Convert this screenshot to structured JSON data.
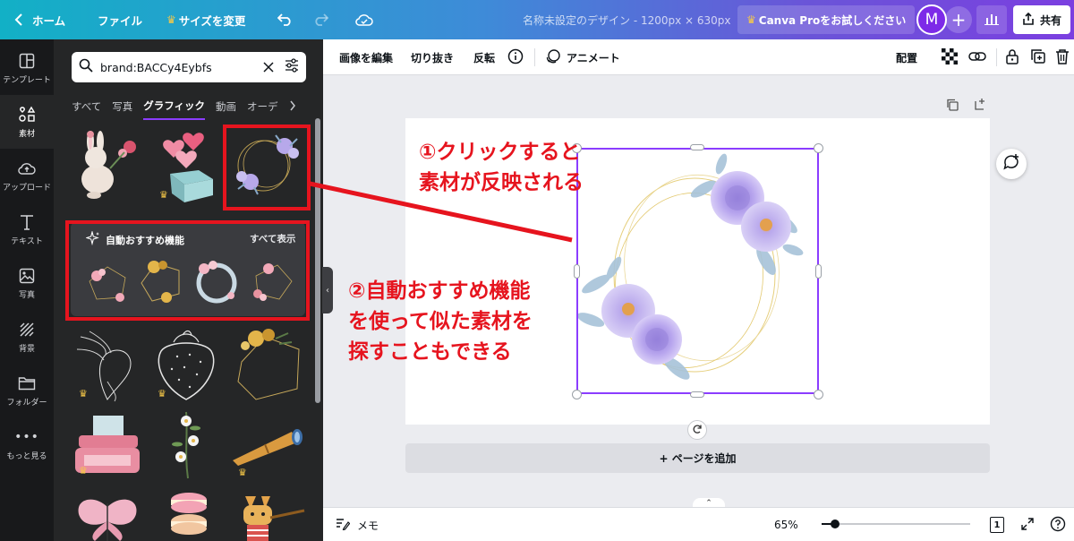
{
  "topbar": {
    "home_label": "ホーム",
    "file_label": "ファイル",
    "resize_label": "サイズを変更",
    "doc_title": "名称未設定のデザイン - 1200px × 630px",
    "pro_label": "Canva Proをお試しください",
    "avatar_initial": "M",
    "share_label": "共有"
  },
  "leftnav": {
    "items": [
      {
        "label": "テンプレート",
        "icon": "template-icon"
      },
      {
        "label": "素材",
        "icon": "elements-icon"
      },
      {
        "label": "アップロード",
        "icon": "upload-icon"
      },
      {
        "label": "テキスト",
        "icon": "text-icon"
      },
      {
        "label": "写真",
        "icon": "photo-icon"
      },
      {
        "label": "背景",
        "icon": "background-icon"
      },
      {
        "label": "フォルダー",
        "icon": "folder-icon"
      },
      {
        "label": "もっと見る",
        "icon": "more-icon"
      }
    ],
    "active": "素材"
  },
  "panel": {
    "search_value": "brand:BACCy4Eybfs",
    "tabs": [
      {
        "label": "すべて",
        "active": false
      },
      {
        "label": "写真",
        "active": false
      },
      {
        "label": "グラフィック",
        "active": true
      },
      {
        "label": "動画",
        "active": false
      },
      {
        "label": "オーデ",
        "active": false
      }
    ],
    "recommend_title": "自動おすすめ機能",
    "recommend_all": "すべて表示"
  },
  "toolbar": {
    "edit_image": "画像を編集",
    "crop": "切り抜き",
    "flip": "反転",
    "animate": "アニメート",
    "position": "配置"
  },
  "canvas": {
    "add_page": "+ ページを追加"
  },
  "bottombar": {
    "notes": "メモ",
    "zoom": "65%",
    "zoom_fraction": 0.09,
    "page_count": "1"
  },
  "annotations": {
    "note1_line1": "①クリックすると",
    "note1_line2": "素材が反映される",
    "note2_line1": "②自動おすすめ機能",
    "note2_line2": "を使って似た素材を",
    "note2_line3": "探すこともできる"
  },
  "colors": {
    "accent": "#8b3dff",
    "annotation_red": "#e6141e",
    "crown": "#f7c948"
  }
}
